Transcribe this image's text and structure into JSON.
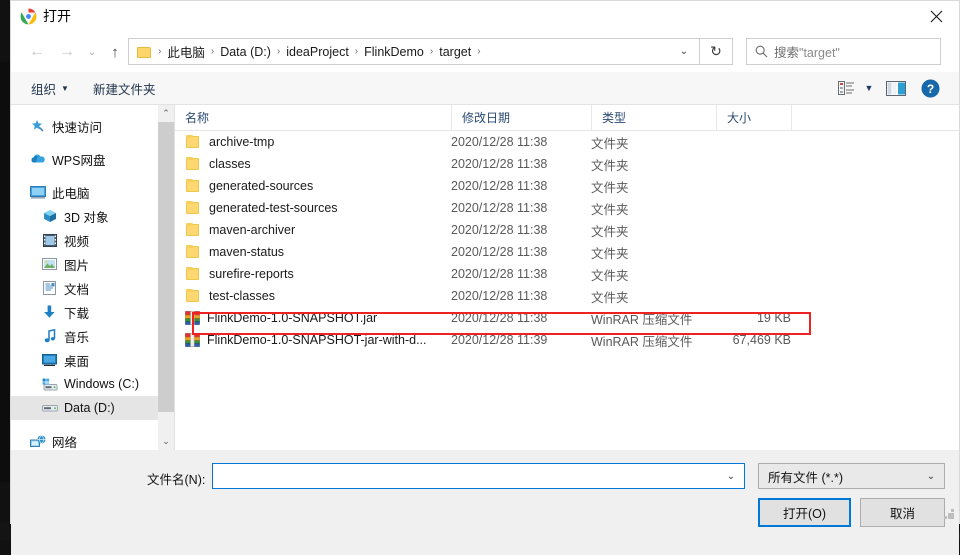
{
  "window": {
    "title": "打开",
    "app_icon": "chrome-icon",
    "close_label": "✕"
  },
  "nav": {
    "back": "←",
    "forward": "→",
    "recent": "⌄",
    "up": "↑",
    "refresh": "↻",
    "breadcrumb": [
      "此电脑",
      "Data (D:)",
      "ideaProject",
      "FlinkDemo",
      "target"
    ],
    "separator": "›",
    "dropdown_caret": "⌄"
  },
  "search": {
    "placeholder_prefix": "搜索",
    "placeholder_target": "\"target\""
  },
  "toolbar": {
    "organize_label": "组织",
    "organize_caret": "▼",
    "new_folder_label": "新建文件夹",
    "view_caret": "▼"
  },
  "sidebar": {
    "items": [
      {
        "label": "快速访问",
        "icon": "star-pin-icon",
        "level": 0,
        "selected": false
      },
      {
        "label": "WPS网盘",
        "icon": "cloud-icon",
        "level": 0,
        "selected": false
      },
      {
        "label": "此电脑",
        "icon": "monitor-icon",
        "level": 0,
        "selected": false
      },
      {
        "label": "3D 对象",
        "icon": "cube-icon",
        "level": 1,
        "selected": false
      },
      {
        "label": "视频",
        "icon": "video-icon",
        "level": 1,
        "selected": false
      },
      {
        "label": "图片",
        "icon": "picture-icon",
        "level": 1,
        "selected": false
      },
      {
        "label": "文档",
        "icon": "document-icon",
        "level": 1,
        "selected": false
      },
      {
        "label": "下载",
        "icon": "download-icon",
        "level": 1,
        "selected": false
      },
      {
        "label": "音乐",
        "icon": "music-icon",
        "level": 1,
        "selected": false
      },
      {
        "label": "桌面",
        "icon": "desktop-icon",
        "level": 1,
        "selected": false
      },
      {
        "label": "Windows (C:)",
        "icon": "windows-drive-icon",
        "level": 1,
        "selected": false
      },
      {
        "label": "Data (D:)",
        "icon": "drive-icon",
        "level": 1,
        "selected": true
      },
      {
        "label": "网络",
        "icon": "network-icon",
        "level": 0,
        "selected": false
      }
    ],
    "scroll_up": "⌃",
    "scroll_down": "⌄"
  },
  "filelist": {
    "columns": [
      "名称",
      "修改日期",
      "类型",
      "大小"
    ],
    "sort_indicator": "⌃",
    "rows": [
      {
        "name": "archive-tmp",
        "date": "2020/12/28 11:38",
        "type": "文件夹",
        "size": "",
        "icon": "folder-icon",
        "highlighted": false
      },
      {
        "name": "classes",
        "date": "2020/12/28 11:38",
        "type": "文件夹",
        "size": "",
        "icon": "folder-icon",
        "highlighted": false
      },
      {
        "name": "generated-sources",
        "date": "2020/12/28 11:38",
        "type": "文件夹",
        "size": "",
        "icon": "folder-icon",
        "highlighted": false
      },
      {
        "name": "generated-test-sources",
        "date": "2020/12/28 11:38",
        "type": "文件夹",
        "size": "",
        "icon": "folder-icon",
        "highlighted": false
      },
      {
        "name": "maven-archiver",
        "date": "2020/12/28 11:38",
        "type": "文件夹",
        "size": "",
        "icon": "folder-icon",
        "highlighted": false
      },
      {
        "name": "maven-status",
        "date": "2020/12/28 11:38",
        "type": "文件夹",
        "size": "",
        "icon": "folder-icon",
        "highlighted": false
      },
      {
        "name": "surefire-reports",
        "date": "2020/12/28 11:38",
        "type": "文件夹",
        "size": "",
        "icon": "folder-icon",
        "highlighted": false
      },
      {
        "name": "test-classes",
        "date": "2020/12/28 11:38",
        "type": "文件夹",
        "size": "",
        "icon": "folder-icon",
        "highlighted": false
      },
      {
        "name": "FlinkDemo-1.0-SNAPSHOT.jar",
        "date": "2020/12/28 11:38",
        "type": "WinRAR 压缩文件",
        "size": "19 KB",
        "icon": "winrar-icon",
        "highlighted": false
      },
      {
        "name": "FlinkDemo-1.0-SNAPSHOT-jar-with-d...",
        "date": "2020/12/28 11:39",
        "type": "WinRAR 压缩文件",
        "size": "67,469 KB",
        "icon": "winrar-icon",
        "highlighted": true
      }
    ],
    "highlight_color": "#ee2222"
  },
  "footer": {
    "filename_label": "文件名(N):",
    "filename_value": "",
    "filename_caret": "⌄",
    "filetype_value": "所有文件 (*.*)",
    "filetype_caret": "⌄",
    "open_button": "打开(O)",
    "cancel_button": "取消"
  },
  "colors": {
    "accent": "#0078d7",
    "highlight": "#ee2222",
    "folder": "#fdd870",
    "crumb_text": "#1a1a1a"
  }
}
